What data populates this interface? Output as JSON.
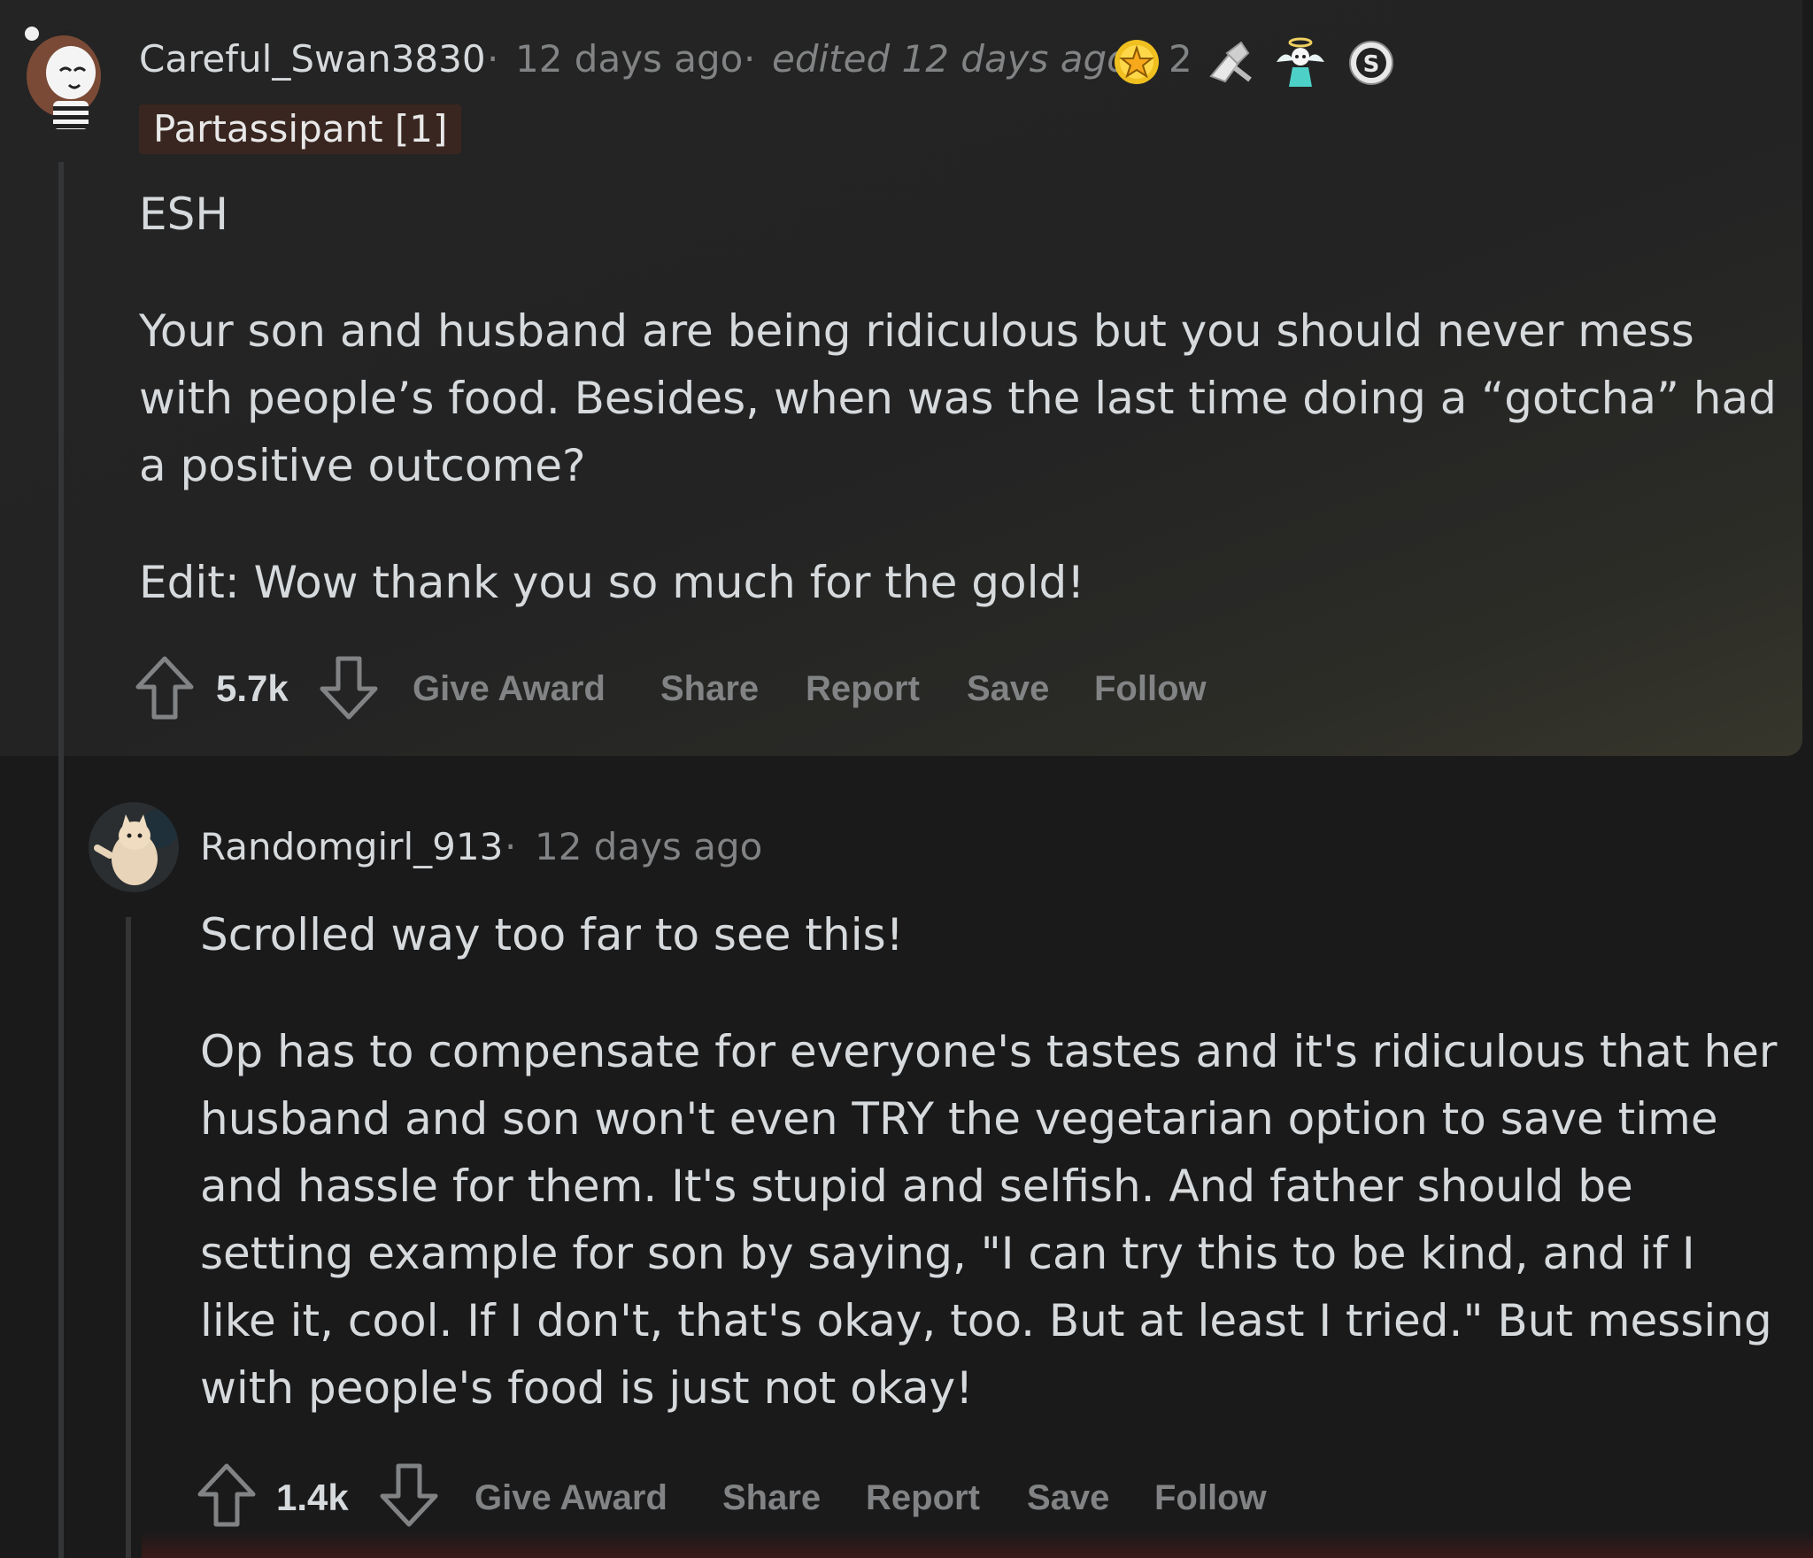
{
  "comments": [
    {
      "username": "Careful_Swan3830",
      "sep1": "·",
      "time": "12 days ago",
      "sep2": "·",
      "edited": "edited 12 days ago",
      "award_count": "2",
      "flair": "Partassipant [1]",
      "paragraphs": [
        "ESH",
        "Your son and husband are being ridiculous but you should never mess with people’s food. Besides, when was the last time doing a “gotcha” had a positive outcome?",
        "Edit: Wow thank you so much for the gold!"
      ],
      "score": "5.7k",
      "actions": [
        "Give Award",
        "Share",
        "Report",
        "Save",
        "Follow"
      ]
    },
    {
      "username": "Randomgirl_913",
      "sep1": "·",
      "time": "12 days ago",
      "paragraphs": [
        "Scrolled way too far to see this!",
        "Op has to compensate for everyone's tastes and it's ridiculous that her husband and son won't even TRY the vegetarian option to save time and hassle for them. It's stupid and selfish. And father should be setting example for son by saying, \"I can try this to be kind, and if I like it, cool. If I don't, that's okay, too. But at least I tried.\" But messing with people's food is just not okay!"
      ],
      "score": "1.4k",
      "actions": [
        "Give Award",
        "Share",
        "Report",
        "Save",
        "Follow"
      ]
    }
  ],
  "colors": {
    "background": "#1a1a1b",
    "panel": "#242424",
    "text": "#d7dadc",
    "muted": "#818384",
    "flair_bg": "#3a2620",
    "gold": "#f0c020"
  },
  "icons": [
    "upvote-icon",
    "downvote-icon",
    "gold-award-icon",
    "helpful-award-icon",
    "angel-award-icon",
    "silver-award-icon",
    "avatar"
  ]
}
